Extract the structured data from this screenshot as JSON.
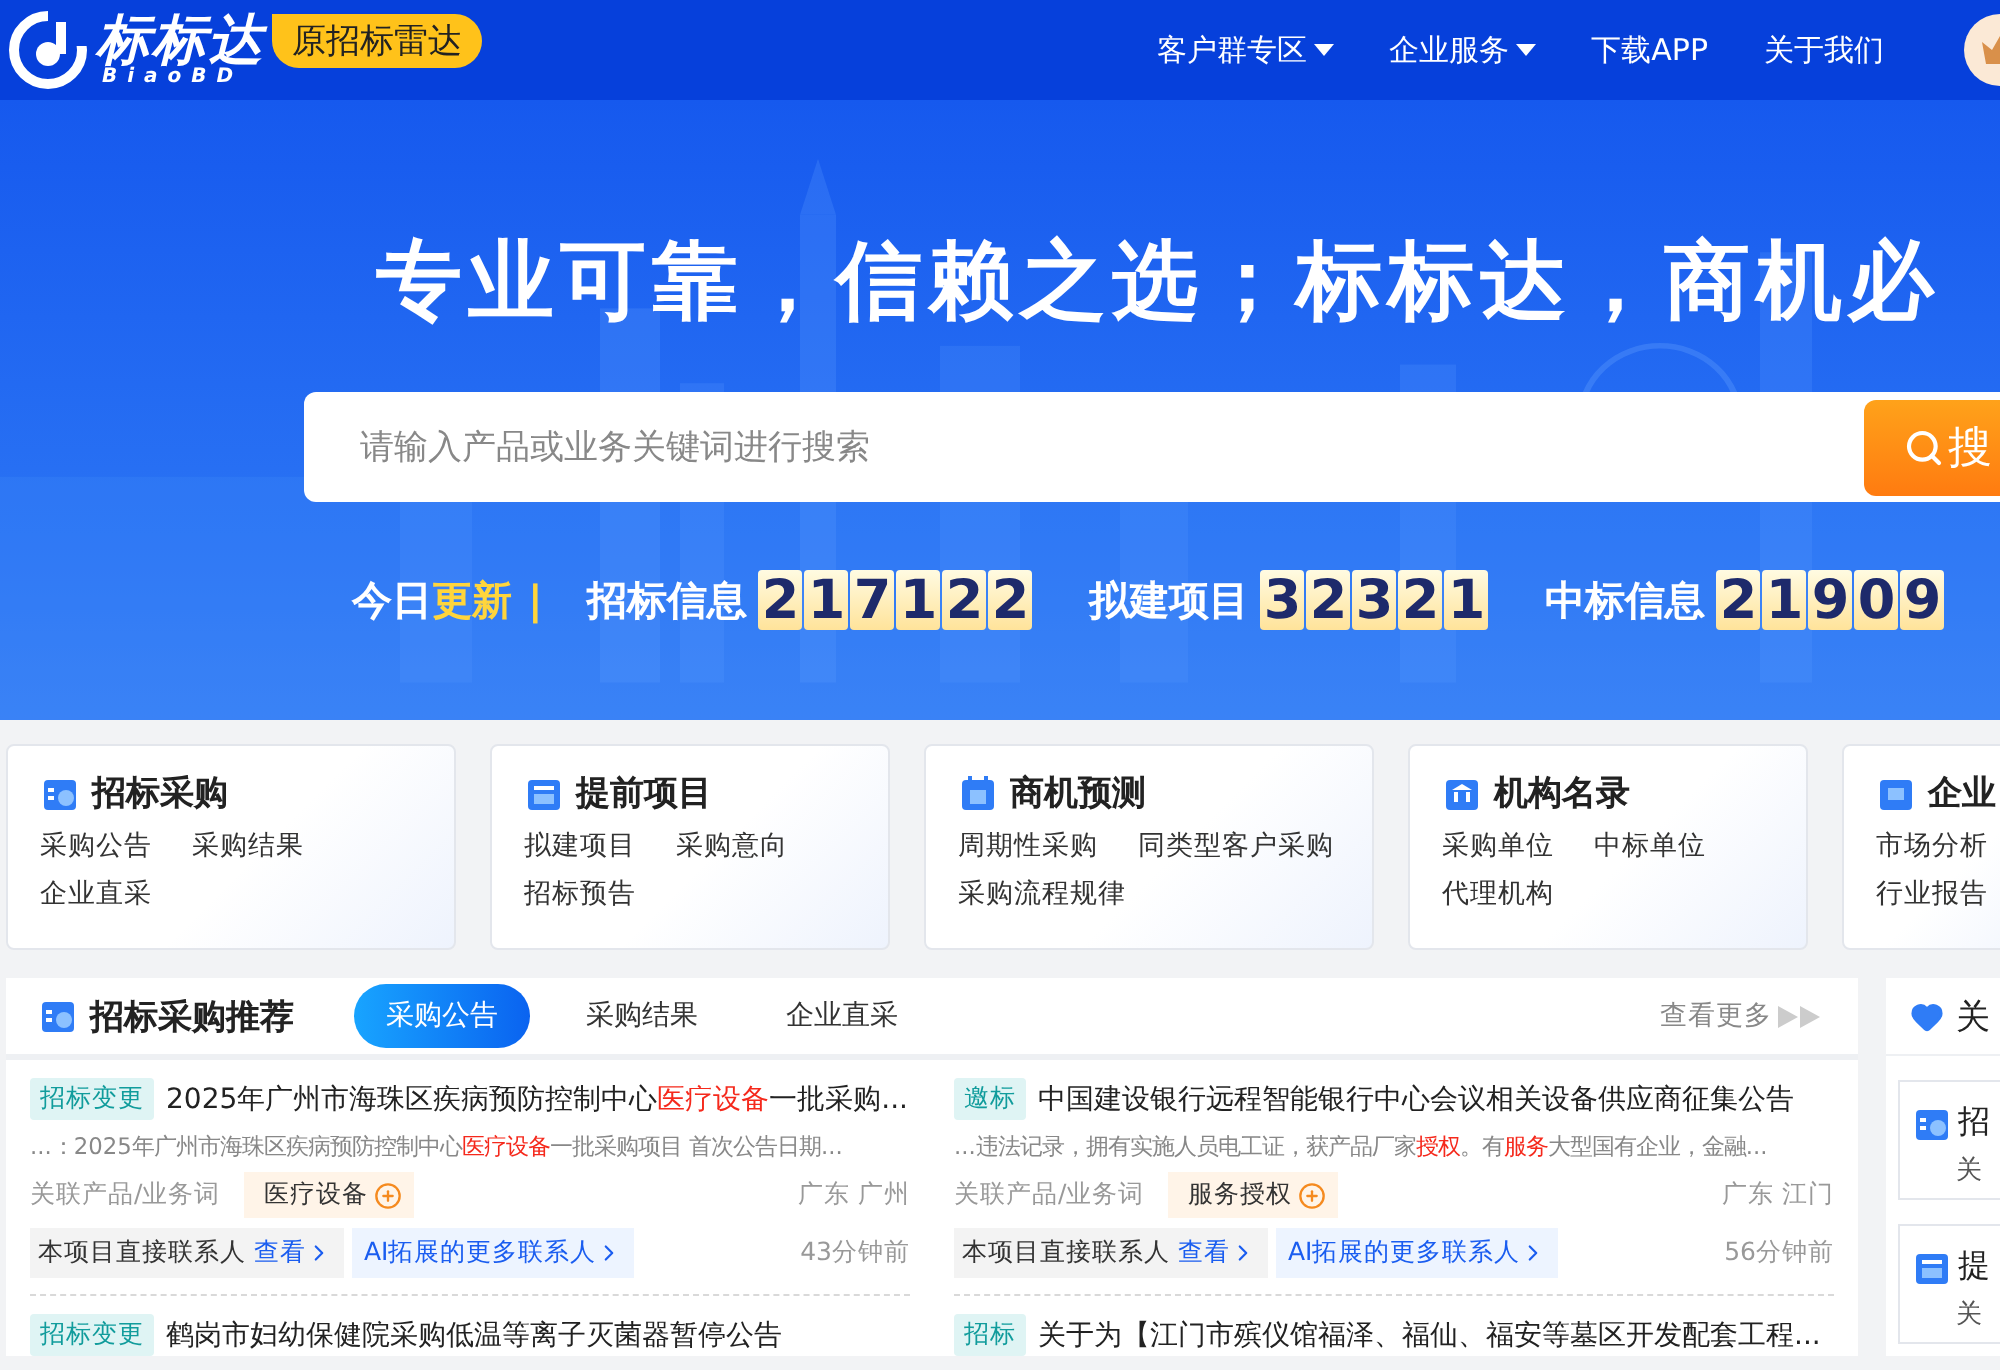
{
  "header": {
    "logo_text": "标标达",
    "logo_subtext": "BiaoBD",
    "badge": "原招标雷达",
    "nav": [
      {
        "label": "客户群专区",
        "dropdown": true
      },
      {
        "label": "企业服务",
        "dropdown": true
      },
      {
        "label": "下载APP",
        "dropdown": false
      },
      {
        "label": "关于我们",
        "dropdown": false
      }
    ]
  },
  "hero": {
    "slogan": "专业可靠，信赖之选；标标达，商机必",
    "search": {
      "placeholder": "请输入产品或业务关键词进行搜索",
      "button": "搜"
    },
    "today": {
      "label": "今日",
      "highlight": "更新",
      "separator": "|"
    },
    "stats": [
      {
        "label": "招标信息",
        "digits": [
          "2",
          "1",
          "7",
          "1",
          "2",
          "2"
        ]
      },
      {
        "label": "拟建项目",
        "digits": [
          "3",
          "2",
          "3",
          "2",
          "1"
        ]
      },
      {
        "label": "中标信息",
        "digits": [
          "2",
          "1",
          "9",
          "0",
          "9"
        ]
      }
    ]
  },
  "categories": [
    {
      "title": "招标采购",
      "links": [
        "采购公告",
        "采购结果",
        "企业直采"
      ]
    },
    {
      "title": "提前项目",
      "links": [
        "拟建项目",
        "采购意向",
        "招标预告"
      ]
    },
    {
      "title": "商机预测",
      "links": [
        "周期性采购",
        "同类型客户采购",
        "采购流程规律"
      ]
    },
    {
      "title": "机构名录",
      "links": [
        "采购单位",
        "中标单位",
        "代理机构"
      ]
    },
    {
      "title": "企业",
      "links": [
        "市场分析",
        "行业报告"
      ]
    }
  ],
  "recommend": {
    "title": "招标采购推荐",
    "tabs": [
      {
        "label": "采购公告",
        "selected": true
      },
      {
        "label": "采购结果",
        "selected": false
      },
      {
        "label": "企业直采",
        "selected": false
      }
    ],
    "more": "查看更多",
    "items": [
      {
        "tag": "招标变更",
        "title": "2025年广州市海珠区疾病预防控制中心**医疗设备**一批采购...",
        "snippet": "...：2025年广州市海珠区疾病预防控制中心**医疗设备**一批采购项目 首次公告日期...",
        "keyword_label": "关联产品/业务词",
        "keyword": "医疗设备",
        "region": "广东 广州",
        "contact_label": "本项目直接联系人",
        "contact_link": "查看",
        "ai_link": "AI拓展的更多联系人",
        "time": "43分钟前"
      },
      {
        "tag": "邀标",
        "title": "中国建设银行远程智能银行中心会议相关设备供应商征集公告",
        "snippet": "...违法记录，拥有实施人员电工证，获产品厂家**授权**。有**服务**大型国有企业，金融...",
        "keyword_label": "关联产品/业务词",
        "keyword": "服务授权",
        "region": "广东 江门",
        "contact_label": "本项目直接联系人",
        "contact_link": "查看",
        "ai_link": "AI拓展的更多联系人",
        "time": "56分钟前"
      },
      {
        "tag": "招标变更",
        "title": "鹤岗市妇幼保健院采购低温等离子灭菌器暂停公告"
      },
      {
        "tag": "招标",
        "title": "关于为【江门市殡仪馆福泽、福仙、福安等墓区开发配套工程..."
      }
    ]
  },
  "sidebar": {
    "title": "关",
    "items": [
      {
        "title": "招",
        "subtitle": "关"
      },
      {
        "title": "提",
        "subtitle": "关"
      }
    ]
  }
}
